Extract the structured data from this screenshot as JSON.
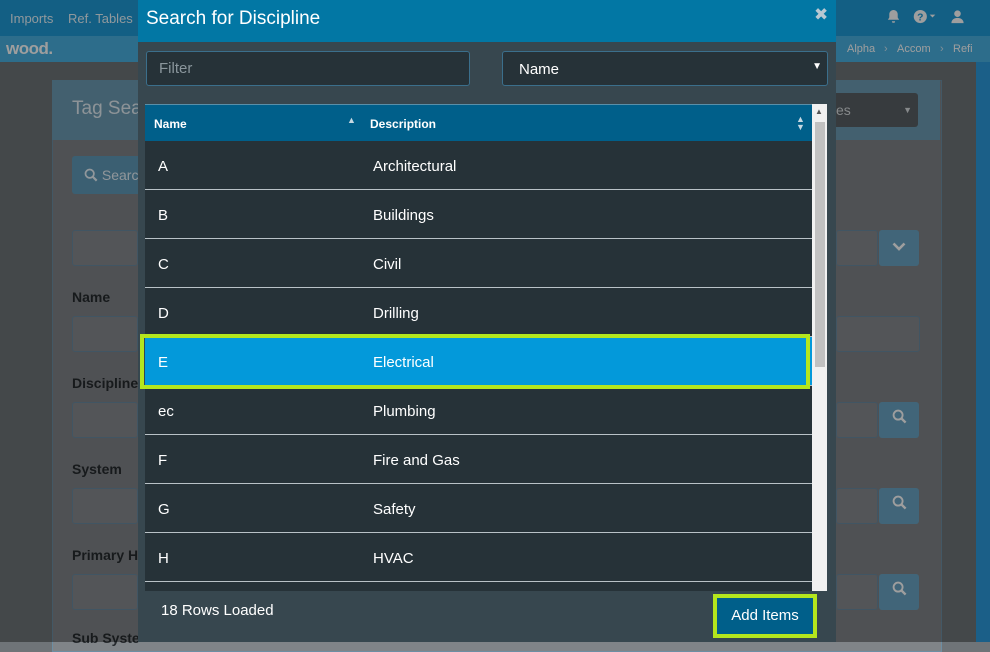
{
  "app": {
    "nav": [
      "Imports",
      "Ref. Tables"
    ],
    "logo": "wood.",
    "breadcrumbs": [
      "Alpha",
      "Accom",
      "Refi"
    ],
    "icons": {
      "bell": "bell-icon",
      "help": "help-icon",
      "user": "user-icon"
    }
  },
  "background": {
    "panel_title": "Tag Sea",
    "search_button": "Searc",
    "right_select": "es",
    "labels": [
      "Name",
      "Discipline",
      "System",
      "Primary H",
      "Sub Syste"
    ]
  },
  "modal": {
    "title": "Search for Discipline",
    "close": "✖",
    "filter_placeholder": "Filter",
    "filter_value": "",
    "select_value": "Name",
    "columns": [
      "Name",
      "Description"
    ],
    "rows": [
      {
        "name": "A",
        "description": "Architectural"
      },
      {
        "name": "B",
        "description": "Buildings"
      },
      {
        "name": "C",
        "description": "Civil"
      },
      {
        "name": "D",
        "description": "Drilling"
      },
      {
        "name": "E",
        "description": "Electrical",
        "selected": true
      },
      {
        "name": "ec",
        "description": "Plumbing"
      },
      {
        "name": "F",
        "description": "Fire and Gas"
      },
      {
        "name": "G",
        "description": "Safety"
      },
      {
        "name": "H",
        "description": "HVAC"
      }
    ],
    "rows_loaded": "18 Rows Loaded",
    "add_button": "Add Items"
  },
  "colors": {
    "accent": "#0277a4",
    "selected_row": "#0399da",
    "highlight": "#b4e61e",
    "modal_bg": "#37474f",
    "grid_bg": "#263238"
  }
}
